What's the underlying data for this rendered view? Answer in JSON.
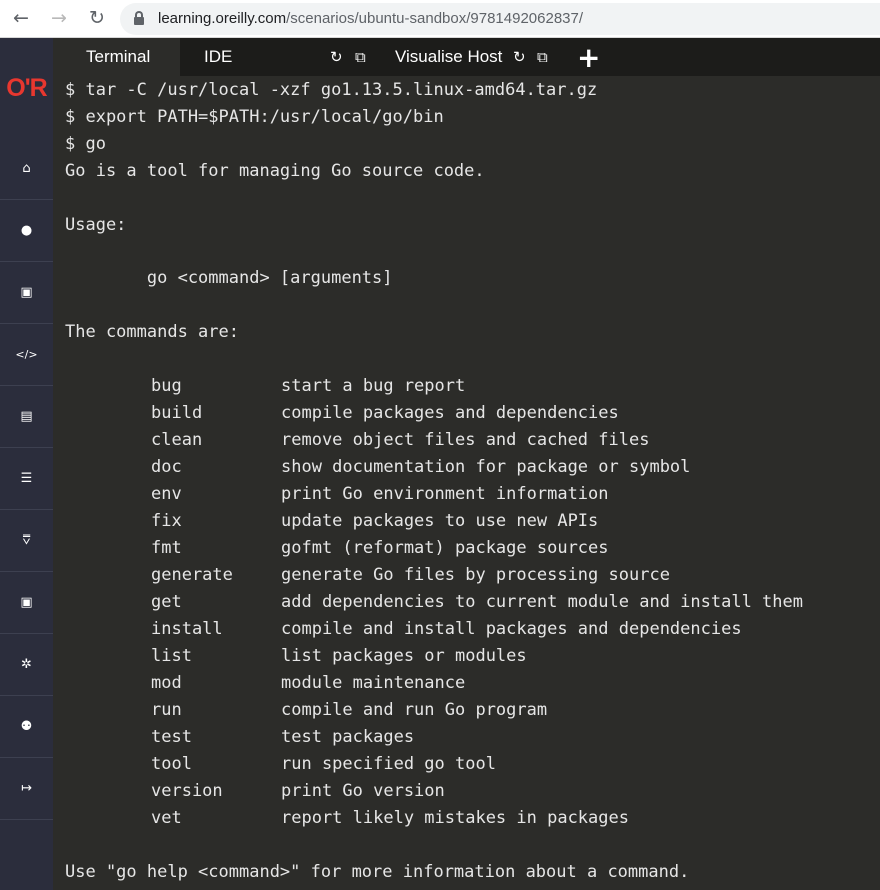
{
  "browser": {
    "url_host": "learning.oreilly.com",
    "url_path": "/scenarios/ubuntu-sandbox/9781492062837/",
    "back_icon": "←",
    "forward_icon": "→",
    "reload_icon": "↻"
  },
  "sidebar": {
    "logo_text": "O'R",
    "items": [
      {
        "icon": "home-icon",
        "glyph": "⌂"
      },
      {
        "icon": "user-icon",
        "glyph": "●"
      },
      {
        "icon": "copy-icon",
        "glyph": "▣"
      },
      {
        "icon": "code-icon",
        "glyph": "</>"
      },
      {
        "icon": "id-card-icon",
        "glyph": "▤"
      },
      {
        "icon": "list-icon",
        "glyph": "☰"
      },
      {
        "icon": "sitemap-icon",
        "glyph": "⩢"
      },
      {
        "icon": "copy-icon-2",
        "glyph": "▣"
      },
      {
        "icon": "gear-icon",
        "glyph": "✲"
      },
      {
        "icon": "user-cog-icon",
        "glyph": "⚉"
      },
      {
        "icon": "sign-out-icon",
        "glyph": "↦"
      }
    ]
  },
  "tabs": {
    "terminal_label": "Terminal",
    "ide_label": "IDE",
    "visualise_label": "Visualise Host",
    "refresh_glyph": "↻",
    "external_glyph": "⧉",
    "plus_glyph": "+"
  },
  "terminal": {
    "lines": [
      "$ tar -C /usr/local -xzf go1.13.5.linux-amd64.tar.gz",
      "$ export PATH=$PATH:/usr/local/go/bin",
      "$ go",
      "Go is a tool for managing Go source code.",
      "Usage:",
      "        go <command> [arguments]",
      "The commands are:"
    ],
    "commands": [
      {
        "name": "bug",
        "desc": "start a bug report"
      },
      {
        "name": "build",
        "desc": "compile packages and dependencies"
      },
      {
        "name": "clean",
        "desc": "remove object files and cached files"
      },
      {
        "name": "doc",
        "desc": "show documentation for package or symbol"
      },
      {
        "name": "env",
        "desc": "print Go environment information"
      },
      {
        "name": "fix",
        "desc": "update packages to use new APIs"
      },
      {
        "name": "fmt",
        "desc": "gofmt (reformat) package sources"
      },
      {
        "name": "generate",
        "desc": "generate Go files by processing source"
      },
      {
        "name": "get",
        "desc": "add dependencies to current module and install them"
      },
      {
        "name": "install",
        "desc": "compile and install packages and dependencies"
      },
      {
        "name": "list",
        "desc": "list packages or modules"
      },
      {
        "name": "mod",
        "desc": "module maintenance"
      },
      {
        "name": "run",
        "desc": "compile and run Go program"
      },
      {
        "name": "test",
        "desc": "test packages"
      },
      {
        "name": "tool",
        "desc": "run specified go tool"
      },
      {
        "name": "version",
        "desc": "print Go version"
      },
      {
        "name": "vet",
        "desc": "report likely mistakes in packages"
      }
    ],
    "footer": "Use \"go help <command>\" for more information about a command."
  }
}
